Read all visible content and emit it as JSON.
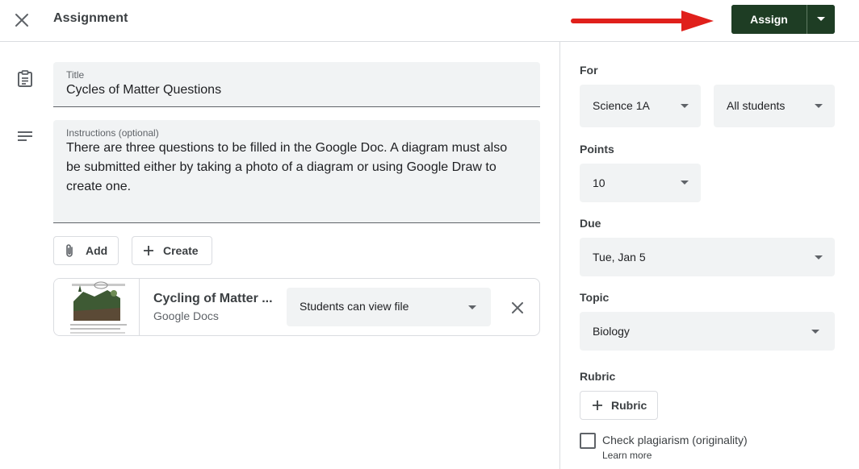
{
  "header": {
    "title": "Assignment",
    "assign_label": "Assign",
    "arrow_color": "#e0201b",
    "assign_color": "#1e3d24"
  },
  "form": {
    "title_label": "Title",
    "title_value": "Cycles of Matter Questions",
    "instructions_label": "Instructions (optional)",
    "instructions_lines": [
      "There are three questions to be filled in the Google Doc. A diagram must also",
      "be submitted either by taking a photo of a diagram or using Google Draw to",
      "create one."
    ],
    "add_label": "Add",
    "create_label": "Create"
  },
  "attachment": {
    "title": "Cycling of Matter ...",
    "type": "Google Docs",
    "permission": "Students can view file"
  },
  "settings": {
    "for_label": "For",
    "class_value": "Science 1A",
    "students_value": "All students",
    "points_label": "Points",
    "points_value": "10",
    "due_label": "Due",
    "due_value": "Tue, Jan 5",
    "topic_label": "Topic",
    "topic_value": "Biology",
    "rubric_label": "Rubric",
    "rubric_button": "Rubric",
    "plagiarism_label": "Check plagiarism (originality)",
    "learn_more": "Learn more"
  },
  "icons": {
    "close": "close-icon",
    "assignment": "clipboard-icon",
    "instructions": "notes-icon",
    "attach": "paperclip-icon",
    "create": "plus-icon"
  }
}
